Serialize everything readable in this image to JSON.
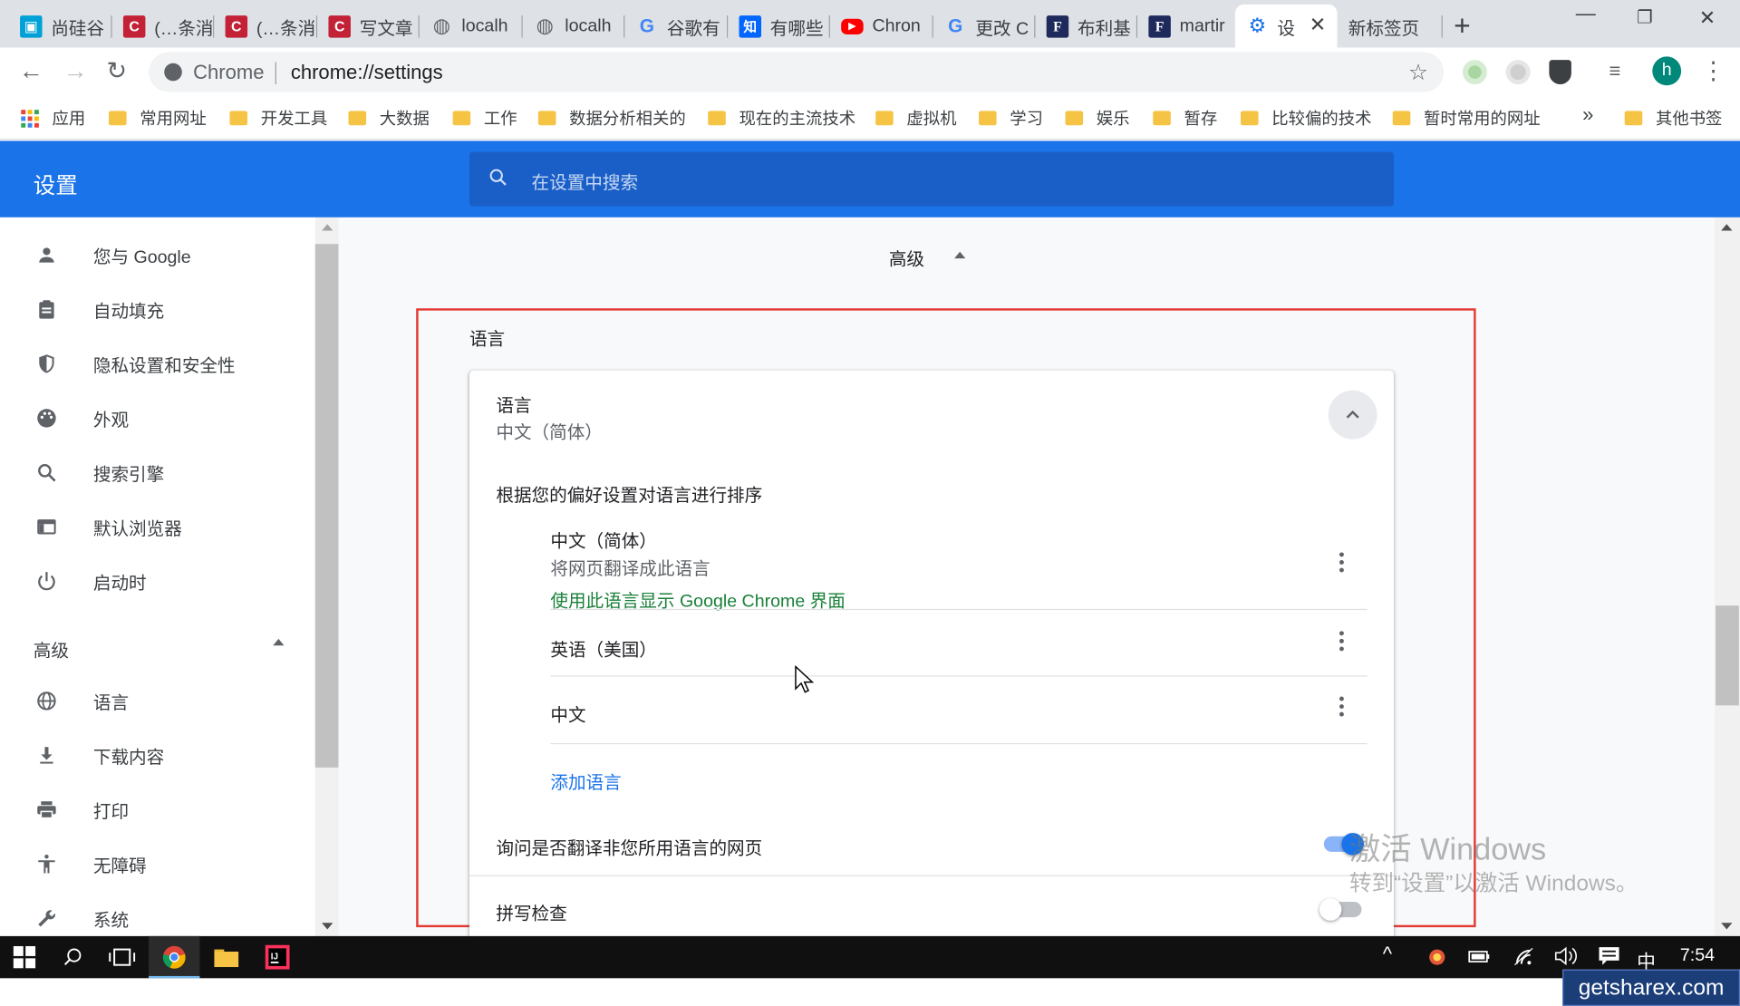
{
  "browser": {
    "tabs": [
      {
        "label": "尚硅谷",
        "icon": "bilibili-icon",
        "color": "#00a1d6",
        "glyph": "▣"
      },
      {
        "label": "(…条消",
        "icon": "csdn-icon",
        "color": "#c32136",
        "glyph": "C"
      },
      {
        "label": "(…条消",
        "icon": "csdn-icon",
        "color": "#c32136",
        "glyph": "C"
      },
      {
        "label": "写文章",
        "icon": "csdn-icon",
        "color": "#c32136",
        "glyph": "C"
      },
      {
        "label": "localh",
        "icon": "globe-icon",
        "color": "#5f6368",
        "glyph": "◍"
      },
      {
        "label": "localh",
        "icon": "globe-icon",
        "color": "#5f6368",
        "glyph": "◍"
      },
      {
        "label": "谷歌有",
        "icon": "google-icon",
        "color": "#4285f4",
        "glyph": "G"
      },
      {
        "label": "有哪些",
        "icon": "zhihu-icon",
        "color": "#0066ff",
        "glyph": "知"
      },
      {
        "label": "Chron",
        "icon": "youtube-icon",
        "color": "#ff0000",
        "glyph": "▶"
      },
      {
        "label": "更改 C",
        "icon": "google-icon",
        "color": "#4285f4",
        "glyph": "G"
      },
      {
        "label": "布利基",
        "icon": "f-icon",
        "color": "#1f2a5c",
        "glyph": "F"
      },
      {
        "label": "martir",
        "icon": "f-icon",
        "color": "#1f2a5c",
        "glyph": "F"
      },
      {
        "label": "设",
        "icon": "settings-gear-icon",
        "color": "#1a73e8",
        "glyph": "⚙",
        "active": true
      },
      {
        "label": "新标签页",
        "icon": "",
        "color": "",
        "glyph": ""
      }
    ],
    "omnibox": {
      "site": "Chrome",
      "url": "chrome://settings"
    },
    "avatar_letter": "h",
    "bookmarks": [
      "应用",
      "常用网址",
      "开发工具",
      "大数据",
      "工作",
      "数据分析相关的",
      "现在的主流技术",
      "虚拟机",
      "学习",
      "娱乐",
      "暂存",
      "比较偏的技术",
      "暂时常用的网址"
    ],
    "bookmarks_more": "»",
    "other_bookmarks": "其他书签"
  },
  "settings": {
    "title": "设置",
    "search_placeholder": "在设置中搜索",
    "sidebar": {
      "items": [
        {
          "label": "您与 Google",
          "icon": "person-icon"
        },
        {
          "label": "自动填充",
          "icon": "clipboard-icon"
        },
        {
          "label": "隐私设置和安全性",
          "icon": "shield-icon"
        },
        {
          "label": "外观",
          "icon": "palette-icon"
        },
        {
          "label": "搜索引擎",
          "icon": "search-icon"
        },
        {
          "label": "默认浏览器",
          "icon": "browser-icon"
        },
        {
          "label": "启动时",
          "icon": "power-icon"
        }
      ],
      "advanced_label": "高级",
      "advanced_items": [
        {
          "label": "语言",
          "icon": "globe-icon"
        },
        {
          "label": "下载内容",
          "icon": "download-icon"
        },
        {
          "label": "打印",
          "icon": "printer-icon"
        },
        {
          "label": "无障碍",
          "icon": "accessibility-icon"
        },
        {
          "label": "系统",
          "icon": "wrench-icon"
        }
      ]
    },
    "main": {
      "advanced_heading": "高级",
      "section_title": "语言",
      "language_card": {
        "title": "语言",
        "current": "中文（简体）",
        "order_heading": "根据您的偏好设置对语言进行排序",
        "languages": [
          {
            "name": "中文（简体）",
            "sub": "将网页翻译成此语言",
            "ui_note": "使用此语言显示 Google Chrome 界面"
          },
          {
            "name": "英语（美国）"
          },
          {
            "name": "中文"
          }
        ],
        "add_language": "添加语言",
        "translate_prompt": "询问是否翻译非您所用语言的网页",
        "translate_enabled": true,
        "spellcheck": "拼写检查",
        "spellcheck_enabled": false
      }
    }
  },
  "watermark": {
    "line1": "激活 Windows",
    "line2": "转到“设置”以激活 Windows。"
  },
  "taskbar": {
    "ime": "中",
    "time": "7:54"
  },
  "getsharex": "getsharex.com",
  "colors": {
    "accent": "#1a73e8",
    "green_link": "#188038",
    "highlight_border": "#e53935"
  }
}
